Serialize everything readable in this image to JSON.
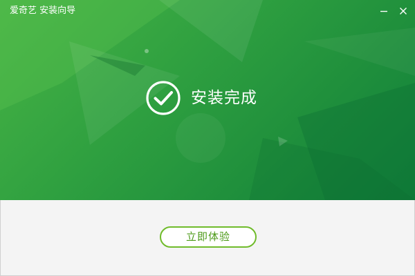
{
  "window": {
    "title": "爱奇艺 安装向导",
    "minimize_icon": "minimize-icon",
    "close_icon": "close-icon"
  },
  "status": {
    "icon": "check-circle-icon",
    "text": "安装完成"
  },
  "actions": {
    "primary_label": "立即体验"
  },
  "colors": {
    "hero_gradient_start": "#48b445",
    "hero_gradient_end": "#107f3a",
    "footer_background": "#f4f4f4",
    "button_border": "#6fbb2a",
    "button_text": "#4c9a18"
  }
}
